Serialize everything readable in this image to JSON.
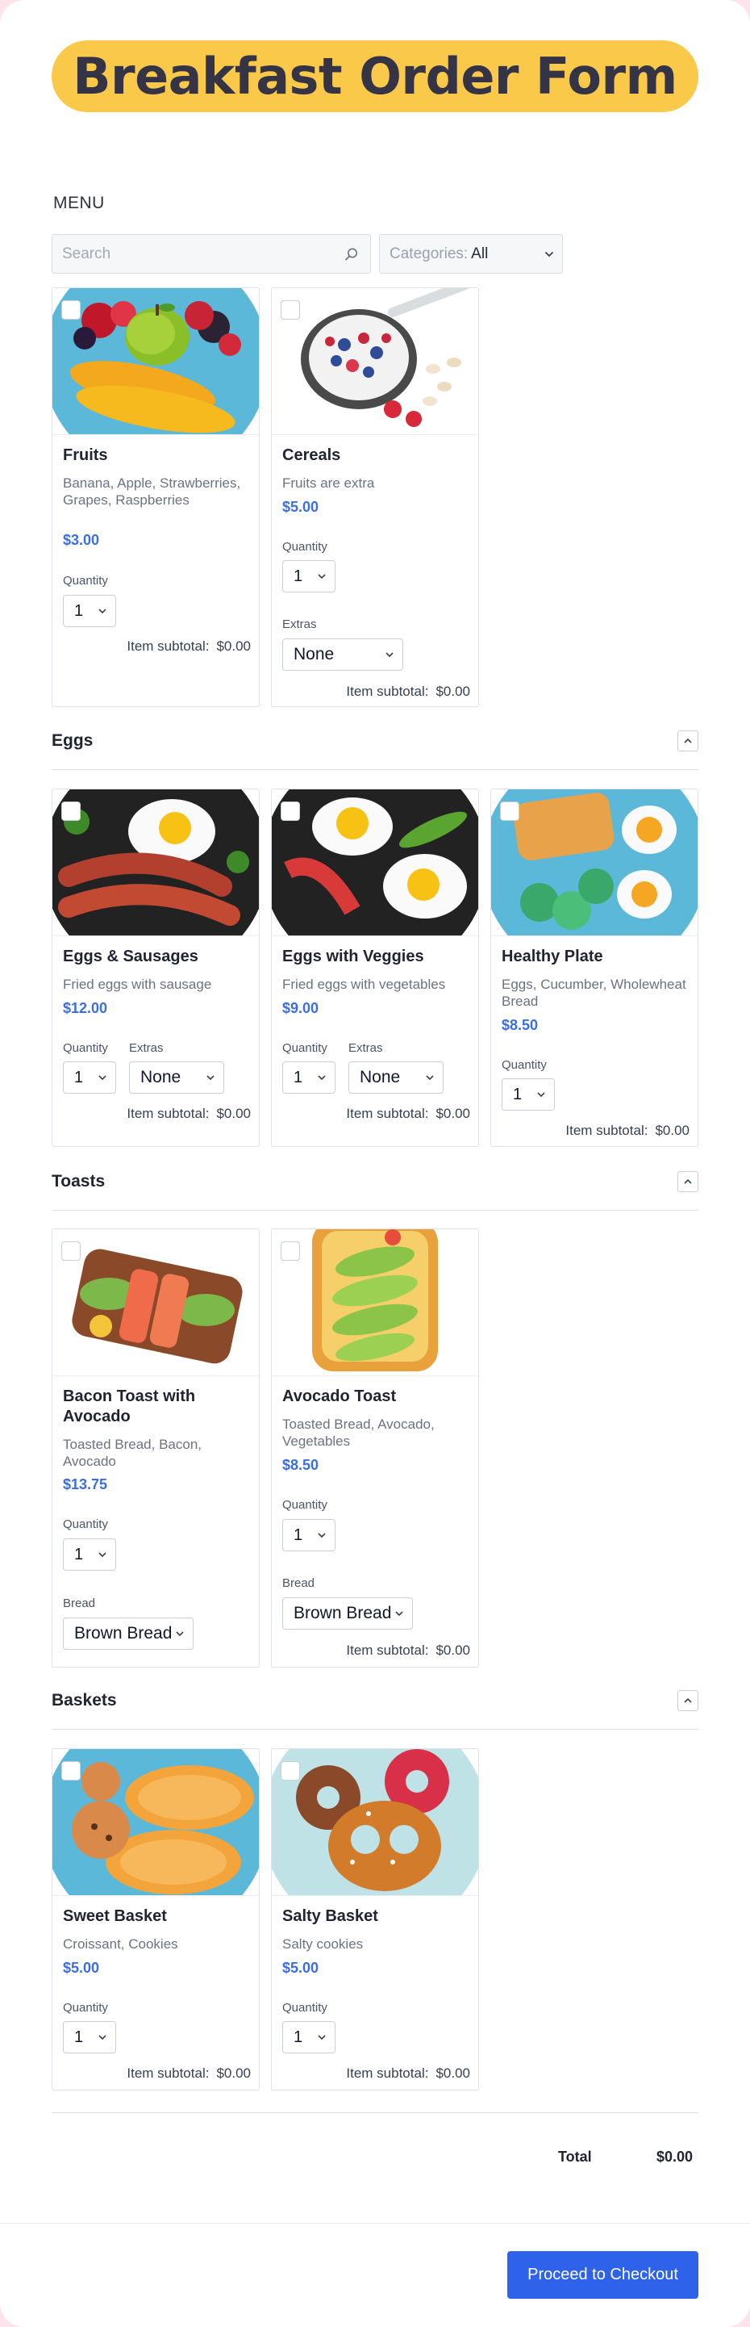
{
  "header": {
    "title": "Breakfast Order Form"
  },
  "menu": {
    "label": "MENU",
    "search_placeholder": "Search",
    "categories_label": "Categories:",
    "categories_value": "All"
  },
  "colors": {
    "accent": "#2f62ea",
    "price": "#3b6fe0",
    "title_bg": "#fbc94a"
  },
  "labels": {
    "quantity": "Quantity",
    "extras": "Extras",
    "bread": "Bread",
    "item_subtotal": "Item subtotal:"
  },
  "top_items": [
    {
      "name": "Fruits",
      "desc": "Banana, Apple, Strawberries, Grapes, Raspberries",
      "price": "$3.00",
      "qty": "1",
      "subtotal": "$0.00"
    },
    {
      "name": "Cereals",
      "desc": "Fruits are extra",
      "price": "$5.00",
      "qty": "1",
      "extras": "None",
      "subtotal": "$0.00"
    }
  ],
  "sections": [
    {
      "title": "Eggs",
      "items": [
        {
          "name": "Eggs & Sausages",
          "desc": "Fried eggs with sausage",
          "price": "$12.00",
          "qty": "1",
          "extras": "None",
          "subtotal": "$0.00"
        },
        {
          "name": "Eggs with Veggies",
          "desc": "Fried eggs with vegetables",
          "price": "$9.00",
          "qty": "1",
          "extras": "None",
          "subtotal": "$0.00"
        },
        {
          "name": "Healthy Plate",
          "desc": "Eggs, Cucumber, Wholewheat Bread",
          "price": "$8.50",
          "qty": "1",
          "subtotal": "$0.00"
        }
      ]
    },
    {
      "title": "Toasts",
      "items": [
        {
          "name": "Bacon Toast with Avocado",
          "desc": "Toasted Bread, Bacon, Avocado",
          "price": "$13.75",
          "qty": "1",
          "bread": "Brown Bread"
        },
        {
          "name": "Avocado Toast",
          "desc": "Toasted Bread, Avocado, Vegetables",
          "price": "$8.50",
          "qty": "1",
          "bread": "Brown Bread",
          "subtotal": "$0.00"
        }
      ]
    },
    {
      "title": "Baskets",
      "items": [
        {
          "name": "Sweet Basket",
          "desc": "Croissant, Cookies",
          "price": "$5.00",
          "qty": "1",
          "subtotal": "$0.00"
        },
        {
          "name": "Salty Basket",
          "desc": "Salty cookies",
          "price": "$5.00",
          "qty": "1",
          "subtotal": "$0.00"
        }
      ]
    }
  ],
  "total": {
    "label": "Total",
    "value": "$0.00"
  },
  "checkout": {
    "label": "Proceed to Checkout"
  },
  "icons": [
    "search-icon",
    "chevron-down-icon",
    "chevron-up-icon",
    "checkbox-icon"
  ]
}
